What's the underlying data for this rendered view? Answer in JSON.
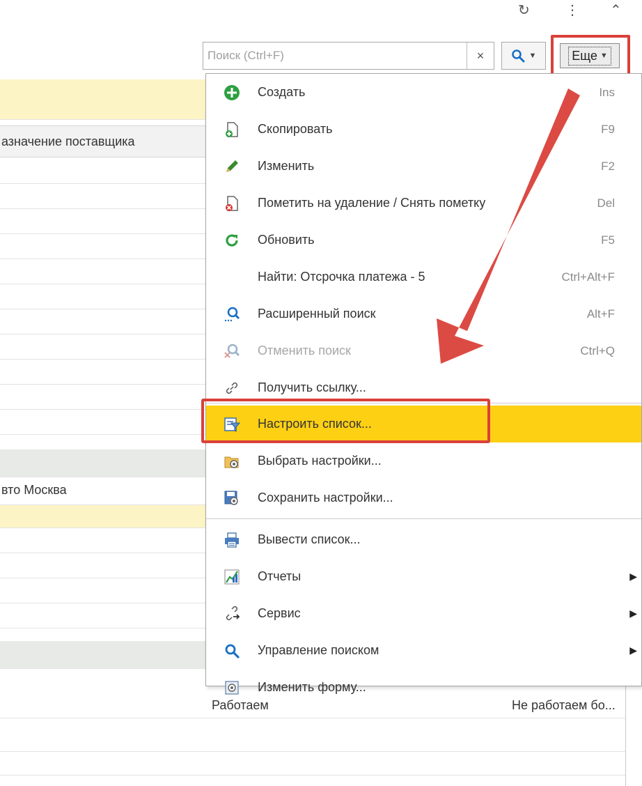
{
  "window_controls": {
    "refresh": "↻",
    "more": "⋮",
    "collapse": "⌃"
  },
  "toolbar": {
    "search_placeholder": "Поиск (Ctrl+F)",
    "clear_label": "×",
    "more_label": "Еще"
  },
  "list": {
    "column_header": "азначение поставщика",
    "row_text": "вто Москва"
  },
  "bottom": {
    "cell_1": "Работаем",
    "cell_2": "Не работаем бо..."
  },
  "menu": {
    "items": [
      {
        "label": "Создать",
        "shortcut": "Ins",
        "icon": "plus-circle-icon"
      },
      {
        "label": "Скопировать",
        "shortcut": "F9",
        "icon": "copy-document-icon"
      },
      {
        "label": "Изменить",
        "shortcut": "F2",
        "icon": "pencil-icon"
      },
      {
        "label": "Пометить на удаление / Снять пометку",
        "shortcut": "Del",
        "icon": "delete-mark-icon"
      },
      {
        "label": "Обновить",
        "shortcut": "F5",
        "icon": "refresh-icon"
      },
      {
        "label": "Найти: Отсрочка платежа - 5",
        "shortcut": "Ctrl+Alt+F",
        "icon": ""
      },
      {
        "label": "Расширенный поиск",
        "shortcut": "Alt+F",
        "icon": "advanced-search-icon"
      },
      {
        "label": "Отменить поиск",
        "shortcut": "Ctrl+Q",
        "icon": "cancel-search-icon",
        "disabled": true
      },
      {
        "label": "Получить ссылку...",
        "shortcut": "",
        "icon": "link-icon"
      },
      {
        "label": "Настроить список...",
        "shortcut": "",
        "icon": "filter-settings-icon",
        "active": true
      },
      {
        "label": "Выбрать настройки...",
        "shortcut": "",
        "icon": "load-settings-icon"
      },
      {
        "label": "Сохранить настройки...",
        "shortcut": "",
        "icon": "save-settings-icon"
      },
      {
        "label": "Вывести список...",
        "shortcut": "",
        "icon": "print-list-icon"
      },
      {
        "label": "Отчеты",
        "shortcut": "",
        "icon": "reports-chart-icon",
        "submenu": true
      },
      {
        "label": "Сервис",
        "shortcut": "",
        "icon": "service-link-icon",
        "submenu": true
      },
      {
        "label": "Управление поиском",
        "shortcut": "",
        "icon": "search-icon",
        "submenu": true
      },
      {
        "label": "Изменить форму...",
        "shortcut": "",
        "icon": "change-form-icon"
      }
    ]
  },
  "colors": {
    "highlight_red": "#d9413a",
    "active_yellow": "#fdd014",
    "band_yellow": "#fdf4c6",
    "band_gray": "#e8eae8"
  }
}
